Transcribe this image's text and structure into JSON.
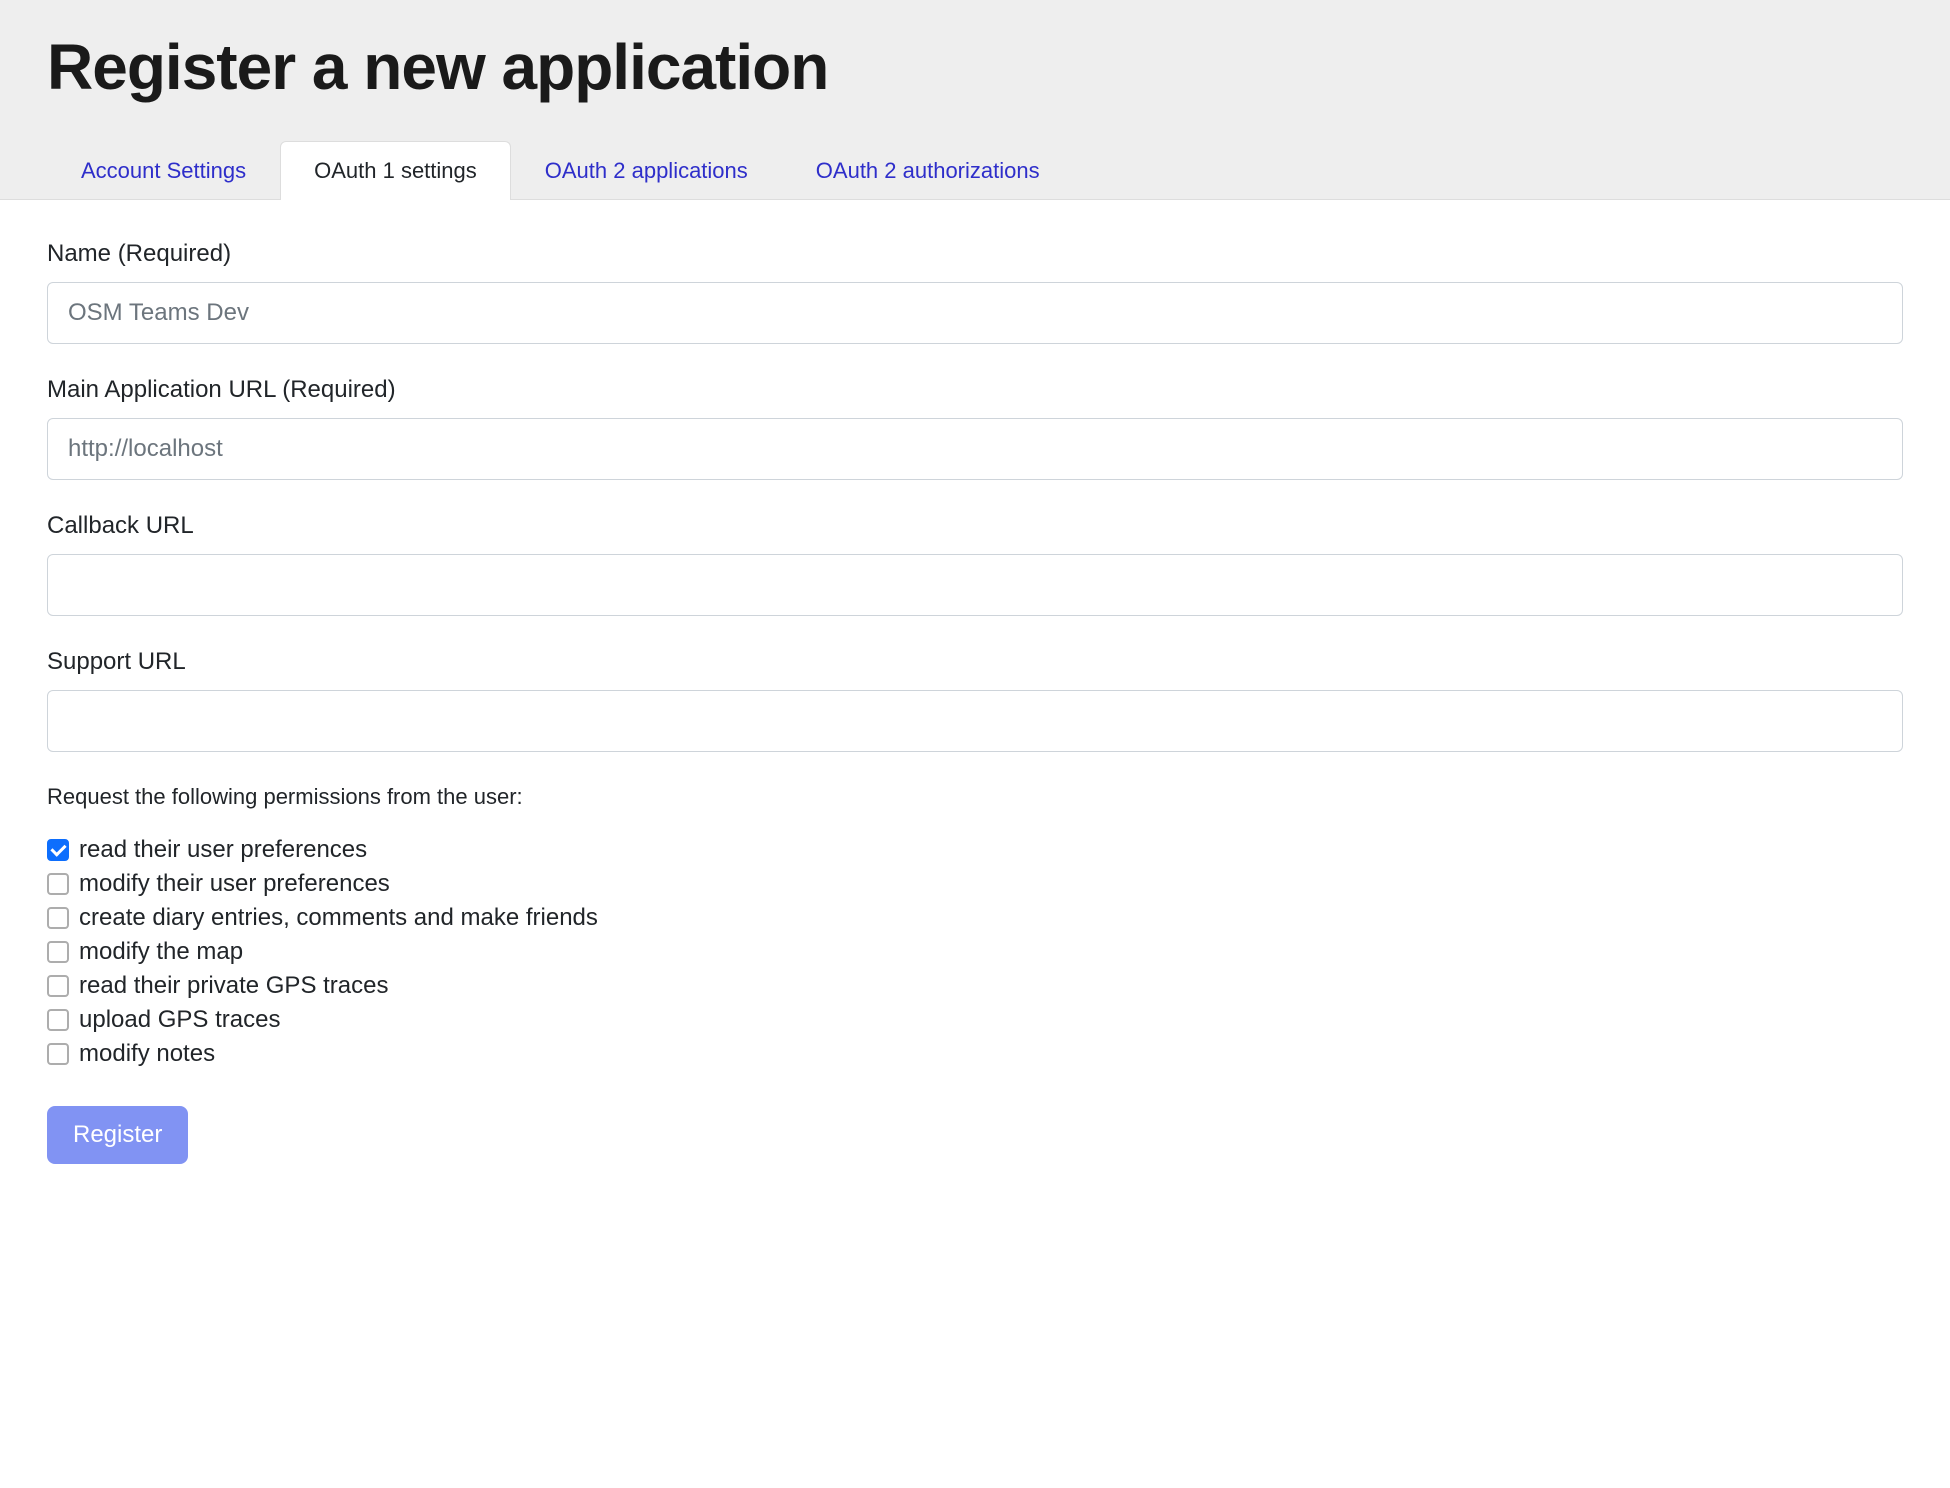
{
  "header": {
    "title": "Register a new application"
  },
  "tabs": [
    {
      "label": "Account Settings",
      "active": false
    },
    {
      "label": "OAuth 1 settings",
      "active": true
    },
    {
      "label": "OAuth 2 applications",
      "active": false
    },
    {
      "label": "OAuth 2 authorizations",
      "active": false
    }
  ],
  "form": {
    "name": {
      "label": "Name (Required)",
      "value": "OSM Teams Dev"
    },
    "main_url": {
      "label": "Main Application URL (Required)",
      "value": "http://localhost"
    },
    "callback_url": {
      "label": "Callback URL",
      "value": ""
    },
    "support_url": {
      "label": "Support URL",
      "value": ""
    },
    "permissions_heading": "Request the following permissions from the user:",
    "permissions": [
      {
        "label": "read their user preferences",
        "checked": true
      },
      {
        "label": "modify their user preferences",
        "checked": false
      },
      {
        "label": "create diary entries, comments and make friends",
        "checked": false
      },
      {
        "label": "modify the map",
        "checked": false
      },
      {
        "label": "read their private GPS traces",
        "checked": false
      },
      {
        "label": "upload GPS traces",
        "checked": false
      },
      {
        "label": "modify notes",
        "checked": false
      }
    ],
    "submit_label": "Register"
  }
}
